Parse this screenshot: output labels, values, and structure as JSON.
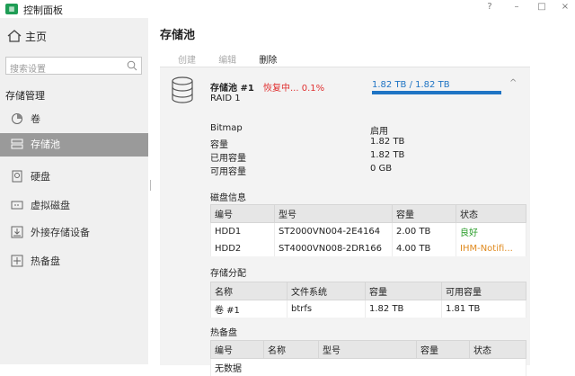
{
  "window": {
    "title": "控制面板",
    "controls": [
      "?",
      "–",
      "□",
      "×"
    ]
  },
  "sidebar": {
    "home": "主页",
    "search_placeholder": "搜索设置",
    "section": "存储管理",
    "items": [
      {
        "label": "卷",
        "icon": "volume-icon"
      },
      {
        "label": "存储池",
        "icon": "storage-pool-icon",
        "active": true
      },
      {
        "label": "硬盘",
        "icon": "disk-icon"
      },
      {
        "label": "虚拟磁盘",
        "icon": "virtual-disk-icon"
      },
      {
        "label": "外接存储设备",
        "icon": "external-storage-icon"
      },
      {
        "label": "热备盘",
        "icon": "hot-spare-icon"
      }
    ]
  },
  "main": {
    "title": "存储池",
    "toolbar": {
      "create": "创建",
      "edit": "编辑",
      "delete": "删除"
    },
    "pool": {
      "name": "存储池 #1",
      "status": "恢复中... 0.1%",
      "raid": "RAID 1",
      "capacity": "1.82 TB / 1.82 TB",
      "usage_fraction": 1.0,
      "properties": [
        {
          "key": "Bitmap",
          "value": "启用"
        },
        {
          "key": "容量",
          "value": "1.82 TB"
        },
        {
          "key": "已用容量",
          "value": "1.82 TB"
        },
        {
          "key": "可用容量",
          "value": "0 GB"
        }
      ],
      "disk_info": {
        "heading": "磁盘信息",
        "columns": [
          "编号",
          "型号",
          "容量",
          "状态"
        ],
        "rows": [
          {
            "id": "HDD1",
            "model": "ST2000VN004-2E4164",
            "capacity": "2.00 TB",
            "status": "良好"
          },
          {
            "id": "HDD2",
            "model": "ST4000VN008-2DR166",
            "capacity": "4.00 TB",
            "status": "IHM-Notifi..."
          }
        ]
      },
      "allocation": {
        "heading": "存储分配",
        "columns": [
          "名称",
          "文件系统",
          "容量",
          "可用容量"
        ],
        "rows": [
          {
            "name": "卷 #1",
            "fs": "btrfs",
            "capacity": "1.82 TB",
            "available": "1.81 TB"
          }
        ]
      },
      "hot_spare": {
        "heading": "热备盘",
        "columns": [
          "编号",
          "名称",
          "型号",
          "容量",
          "状态"
        ],
        "empty_text": "无数据"
      }
    }
  },
  "colors": {
    "accent": "#1f74c4",
    "error": "#e03030",
    "good": "#2a9d2a",
    "warn": "#e08a1e",
    "sidebar_active": "#9a9a9a"
  }
}
